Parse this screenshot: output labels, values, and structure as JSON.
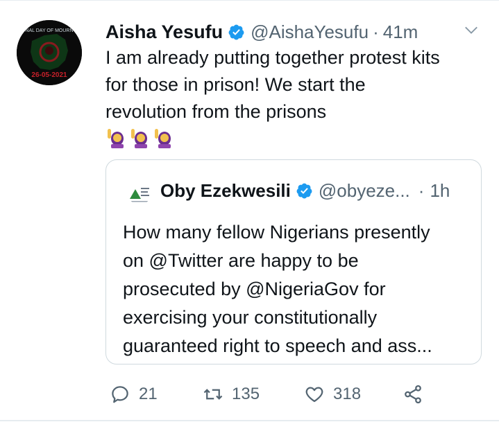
{
  "tweet": {
    "author_name": "Aisha Yesufu",
    "handle": "@AishaYesufu",
    "separator": "·",
    "time": "41m",
    "text_lines": [
      "I am already putting together protest kits",
      "for those in prison! We start the",
      "revolution from the prisons"
    ],
    "emojis": [
      "🙋‍♀️",
      "🙋‍♀️",
      "🙋‍♀️"
    ],
    "avatar": {
      "top_text": "NAL DAY OF MOURN",
      "date_text": "26-05-2021",
      "colors": {
        "bg": "#0a0a0a",
        "map": "#0e3b17",
        "date": "#c8202a"
      }
    }
  },
  "quote": {
    "author_name": "Oby Ezekwesili",
    "handle": "@obyeze...",
    "separator": "·",
    "time": "1h",
    "text_lines": [
      "How many fellow Nigerians presently",
      "on @Twitter are happy to be",
      "prosecuted by @NigeriaGov for",
      "exercising your constitutionally",
      "guaranteed right to speech and ass..."
    ]
  },
  "actions": {
    "reply_count": "21",
    "retweet_count": "135",
    "like_count": "318"
  },
  "colors": {
    "verified": "#1d9bf0",
    "text": "#0f1419",
    "secondary": "#536471",
    "border": "#cfd9de"
  },
  "icons": [
    "verified-badge-icon",
    "chevron-down-icon",
    "reply-icon",
    "retweet-icon",
    "like-icon",
    "share-icon"
  ]
}
